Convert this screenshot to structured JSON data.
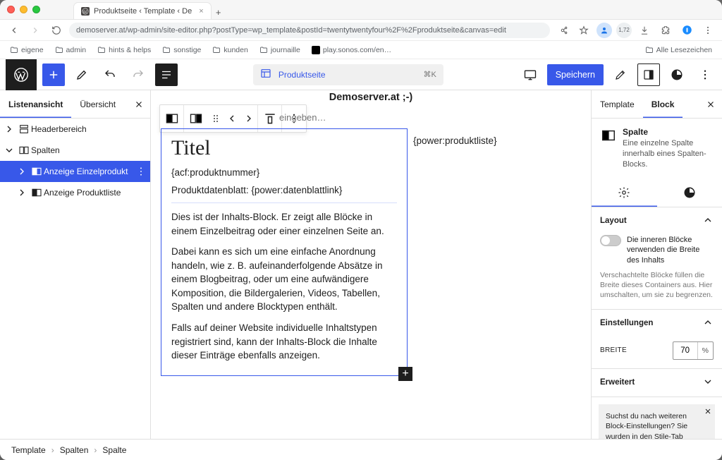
{
  "browser": {
    "tab_title": "Produktseite ‹ Template ‹ De",
    "url": "demoserver.at/wp-admin/site-editor.php?postType=wp_template&postId=twentytwentyfour%2F%2Fproduktseite&canvas=edit",
    "bookmarks": [
      "eigene",
      "admin",
      "hints & helps",
      "sonstige",
      "kunden",
      "journaille",
      "play.sonos.com/en…"
    ],
    "all_bookmarks": "Alle Lesezeichen",
    "ext_badge": "1,72"
  },
  "topbar": {
    "doc_title": "Produktseite",
    "shortcut": "⌘K",
    "save": "Speichern"
  },
  "listview": {
    "tabs": [
      "Listenansicht",
      "Übersicht"
    ],
    "tree": {
      "header": "Headerbereich",
      "columns": "Spalten",
      "single": "Anzeige Einzelprodukt",
      "list": "Anzeige Produktliste"
    }
  },
  "canvas": {
    "site_title": "Demoserver.at ;-)",
    "nav_placeholder": "eingeben…",
    "title": "Titel",
    "acf_line": "{acf:produktnummer}",
    "datasheet": "Produktdatenblatt: {power:datenblattlink}",
    "p1": "Dies ist der Inhalts-Block. Er zeigt alle Blöcke in einem Einzelbeitrag oder einer einzelnen Seite an.",
    "p2": "Dabei kann es sich um eine einfache Anordnung handeln, wie z. B. aufeinanderfolgende Absätze in einem Blogbeitrag, oder um eine aufwändigere Komposition, die Bildergalerien, Videos, Tabellen, Spalten und andere Blocktypen enthält.",
    "p3": "Falls auf deiner Website individuelle Inhaltstypen registriert sind, kann der Inhalts-Block die Inhalte dieser Einträge ebenfalls anzeigen.",
    "side_shortcode": "{power:produktliste}"
  },
  "inspector": {
    "tabs": [
      "Template",
      "Block"
    ],
    "block_name": "Spalte",
    "block_desc": "Eine einzelne Spalte innerhalb eines Spalten-Blocks.",
    "section_layout": "Layout",
    "toggle_label": "Die inneren Blöcke verwenden die Breite des Inhalts",
    "toggle_help": "Verschachtelte Blöcke füllen die Breite dieses Containers aus. Hier umschalten, um sie zu begrenzen.",
    "section_settings": "Einstellungen",
    "width_label": "BREITE",
    "width_value": "70",
    "width_unit": "%",
    "section_advanced": "Erweitert",
    "notice": "Suchst du nach weiteren Block-Einstellungen? Sie wurden in den Stile-Tab verschoben."
  },
  "breadcrumbs": [
    "Template",
    "Spalten",
    "Spalte"
  ]
}
